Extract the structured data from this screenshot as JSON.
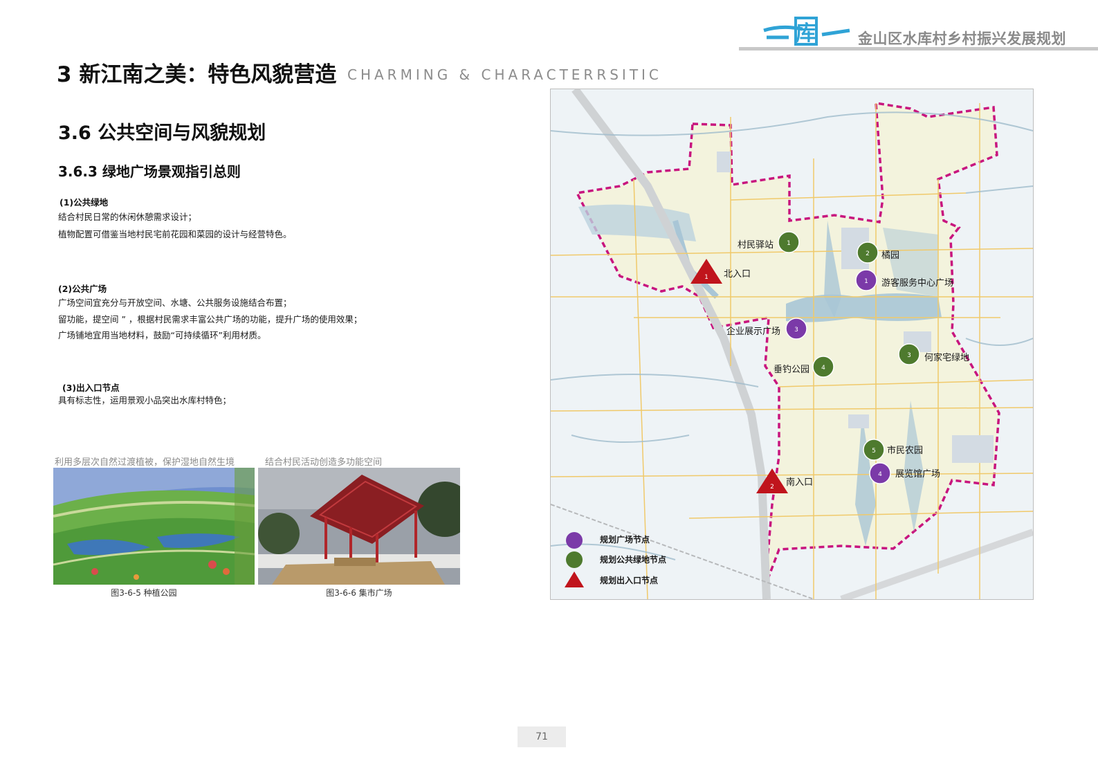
{
  "header": {
    "logo_text": "库",
    "title": "金山区水库村乡村振兴发展规划"
  },
  "chapter": {
    "title": "3 新江南之美：特色风貌营造",
    "english": "CHARMING & CHARACTERRSITIC"
  },
  "section": {
    "title": "3.6 公共空间与风貌规划",
    "subtitle": "3.6.3 绿地广场景观指引总则"
  },
  "blocks": [
    {
      "title": "(1)公共绿地",
      "lines": [
        "结合村民日常的休闲休憩需求设计；",
        "植物配置可借鉴当地村民宅前花园和菜园的设计与经营特色。"
      ]
    },
    {
      "title": "(2)公共广场",
      "lines": [
        "广场空间宜充分与开放空间、水塘、公共服务设施结合布置；",
        "留功能，提空间 ” ，根据村民需求丰富公共广场的功能，提升广场的使用效果；",
        "广场铺地宜用当地材料，鼓励“可持续循环”利用材质。"
      ]
    },
    {
      "title": "(3)出入口节点",
      "lines": [
        "具有标志性，运用景观小品突出水库村特色；"
      ]
    }
  ],
  "photos": [
    {
      "caption": "利用多层次自然过渡植被，保护湿地自然生境",
      "figure": "图3-6-5 种植公园"
    },
    {
      "caption": "结合村民活动创造多功能空间",
      "figure": "图3-6-6 集市广场"
    }
  ],
  "map": {
    "colors": {
      "plaza": "#7b3aa8",
      "green": "#4e7a2e",
      "entrance": "#c0141c",
      "boundary": "#c8157e"
    },
    "markers": [
      {
        "kind": "green",
        "num": "1",
        "label": "村民驿站"
      },
      {
        "kind": "green",
        "num": "2",
        "label": "橘园"
      },
      {
        "kind": "plaza",
        "num": "1",
        "label": "游客服务中心广场"
      },
      {
        "kind": "entrance",
        "num": "1",
        "label": "北入口"
      },
      {
        "kind": "plaza",
        "num": "3",
        "label": "企业展示广场"
      },
      {
        "kind": "green",
        "num": "3",
        "label": "何家宅绿地"
      },
      {
        "kind": "green",
        "num": "4",
        "label": "垂钓公园"
      },
      {
        "kind": "green",
        "num": "5",
        "label": "市民农园"
      },
      {
        "kind": "plaza",
        "num": "4",
        "label": "展览馆广场"
      },
      {
        "kind": "entrance",
        "num": "2",
        "label": "南入口"
      }
    ],
    "legend": [
      {
        "kind": "plaza",
        "label": "规划广场节点"
      },
      {
        "kind": "green",
        "label": "规划公共绿地节点"
      },
      {
        "kind": "entrance",
        "label": "规划出入口节点"
      }
    ]
  },
  "page_number": "71"
}
